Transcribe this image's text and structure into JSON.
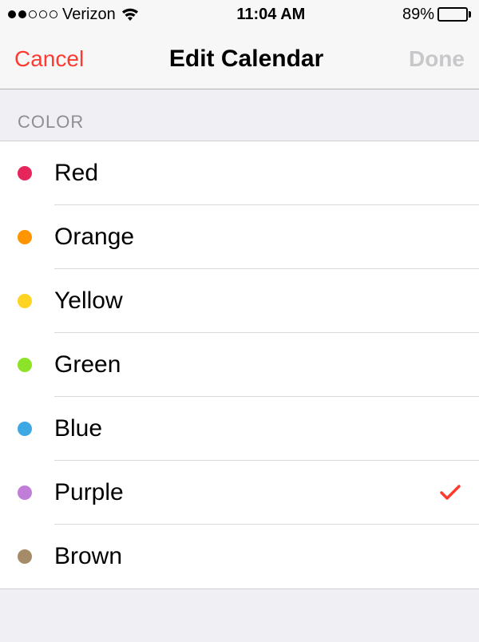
{
  "status_bar": {
    "carrier": "Verizon",
    "time": "11:04 AM",
    "battery_pct": "89%",
    "battery_level": 89,
    "signal_filled": 2,
    "signal_total": 5
  },
  "nav": {
    "cancel_label": "Cancel",
    "title": "Edit Calendar",
    "done_label": "Done"
  },
  "section": {
    "header": "COLOR"
  },
  "colors": [
    {
      "label": "Red",
      "hex": "#e6265b",
      "selected": false
    },
    {
      "label": "Orange",
      "hex": "#ff9500",
      "selected": false
    },
    {
      "label": "Yellow",
      "hex": "#ffd321",
      "selected": false
    },
    {
      "label": "Green",
      "hex": "#8ce328",
      "selected": false
    },
    {
      "label": "Blue",
      "hex": "#3ea8e5",
      "selected": false
    },
    {
      "label": "Purple",
      "hex": "#c07ed9",
      "selected": true
    },
    {
      "label": "Brown",
      "hex": "#a58b67",
      "selected": false
    }
  ],
  "accent_color": "#ff3b30"
}
